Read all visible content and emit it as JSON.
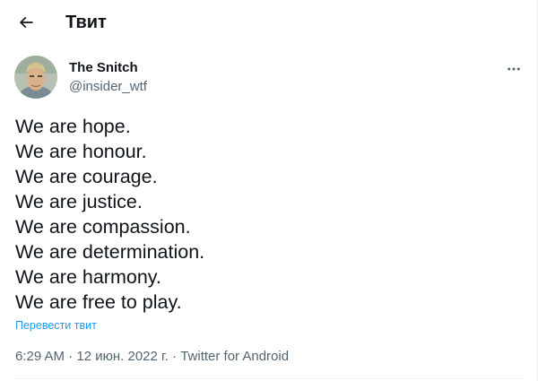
{
  "header": {
    "title": "Твит"
  },
  "author": {
    "name": "The Snitch",
    "handle": "@insider_wtf"
  },
  "tweet": {
    "lines": [
      "We are hope.",
      "We are honour.",
      "We are courage.",
      "We are justice.",
      "We are compassion.",
      "We are determination.",
      "We are harmony.",
      "We are free to play."
    ],
    "translate_label": "Перевести твит"
  },
  "meta": {
    "time": "6:29 AM",
    "separator": " · ",
    "date": "12 июн. 2022 г.",
    "source": "Twitter for Android"
  },
  "colors": {
    "text": "#0f1419",
    "secondary": "#536471",
    "link": "#1d9bf0",
    "divider": "#eff3f4"
  },
  "icons": {
    "back": "arrow-left-icon",
    "more": "more-horizontal-icon"
  }
}
